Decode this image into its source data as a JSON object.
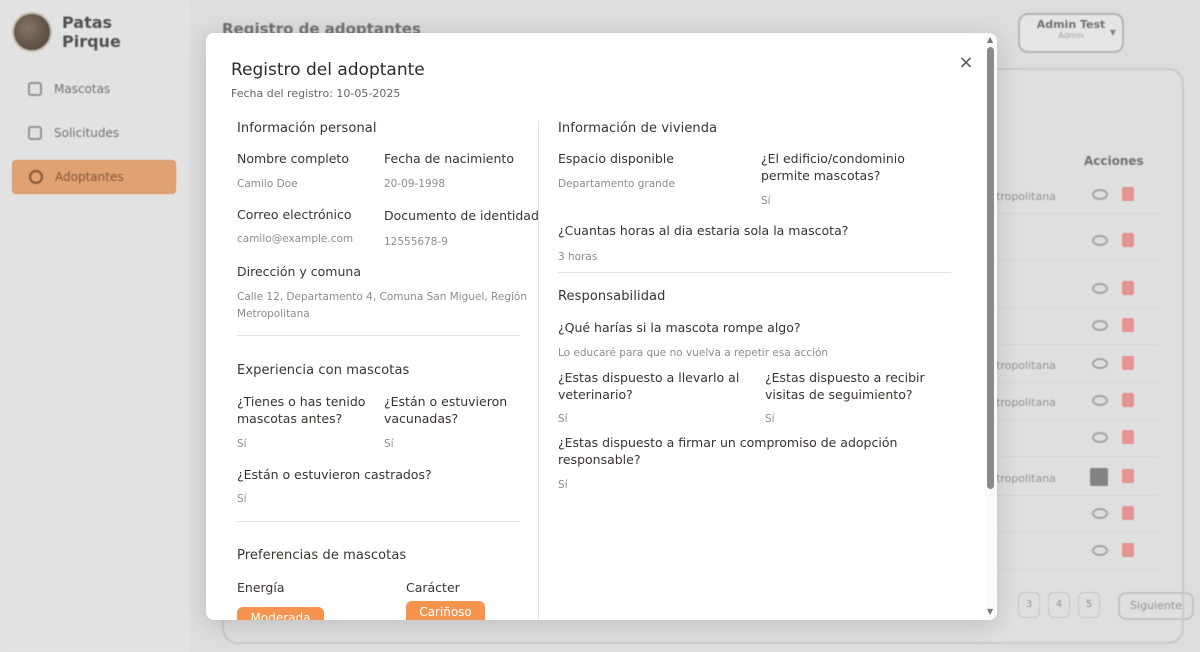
{
  "sidebar": {
    "brand_line1": "Patas",
    "brand_line2": "Pirque",
    "items": [
      {
        "label": "Mascotas",
        "icon": "paw-icon"
      },
      {
        "label": "Solicitudes",
        "icon": "document-icon"
      },
      {
        "label": "Adoptantes",
        "icon": "users-icon"
      }
    ]
  },
  "header": {
    "title": "Registro de adoptantes",
    "user_name": "Admin Test",
    "user_role": "Admin"
  },
  "table": {
    "actions_header": "Acciones",
    "rows": [
      {
        "address_fragment": "tropolitana"
      },
      {
        "address_fragment": ""
      },
      {
        "address_fragment": ""
      },
      {
        "address_fragment": ""
      },
      {
        "address_fragment": "tropolitana"
      },
      {
        "address_fragment": "tropolitana"
      },
      {
        "address_fragment": ""
      },
      {
        "address_fragment": "tropolitana"
      },
      {
        "address_fragment": ""
      },
      {
        "address_fragment": ""
      }
    ]
  },
  "pagination": {
    "pages": [
      "3",
      "4",
      "5"
    ],
    "next_label": "Siguiente"
  },
  "modal": {
    "title": "Registro del adoptante",
    "subtitle": "Fecha del registro: 10-05-2025",
    "close_symbol": "×",
    "personal": {
      "heading": "Información personal",
      "name_label": "Nombre completo",
      "name_value": "Camilo Doe",
      "birth_label": "Fecha de nacimiento",
      "birth_value": "20-09-1998",
      "email_label": "Correo electrónico",
      "email_value": "camilo@example.com",
      "id_label": "Documento de identidad",
      "id_value": "12555678-9",
      "address_label": "Dirección y comuna",
      "address_value": "Calle 12, Departamento 4, Comuna San Miguel, Región Metropolitana"
    },
    "experience": {
      "heading": "Experiencia con mascotas",
      "had_pets_label": "¿Tienes o has tenido mascotas antes?",
      "had_pets_value": "Sí",
      "vaccinated_label": "¿Están o estuvieron vacunadas?",
      "vaccinated_value": "Sí",
      "neutered_label": "¿Están o estuvieron castrados?",
      "neutered_value": "Sí"
    },
    "preferences": {
      "heading": "Preferencias de mascotas",
      "energy_label": "Energía",
      "energy_value": "Moderada",
      "character_label": "Carácter",
      "character_value": "Cariñoso"
    },
    "housing": {
      "heading": "Información de vivienda",
      "space_label": "Espacio disponible",
      "space_value": "Departamento grande",
      "building_label": "¿El edificio/condominio permite mascotas?",
      "building_value": "Sí",
      "hours_label": "¿Cuantas horas al dia estaria sola la mascota?",
      "hours_value": "3 horas"
    },
    "responsibility": {
      "heading": "Responsabilidad",
      "breaks_label": "¿Qué harías si la mascota rompe algo?",
      "breaks_value": "Lo educaré para que no vuelva a repetir esa acción",
      "vet_label": "¿Estas dispuesto a llevarlo al veterinario?",
      "vet_value": "Sí",
      "visits_label": "¿Estas dispuesto a recibir visitas de seguimiento?",
      "visits_value": "Sí",
      "commitment_label": "¿Estas dispuesto a firmar un compromiso de adopción responsable?",
      "commitment_value": "Sí"
    }
  }
}
